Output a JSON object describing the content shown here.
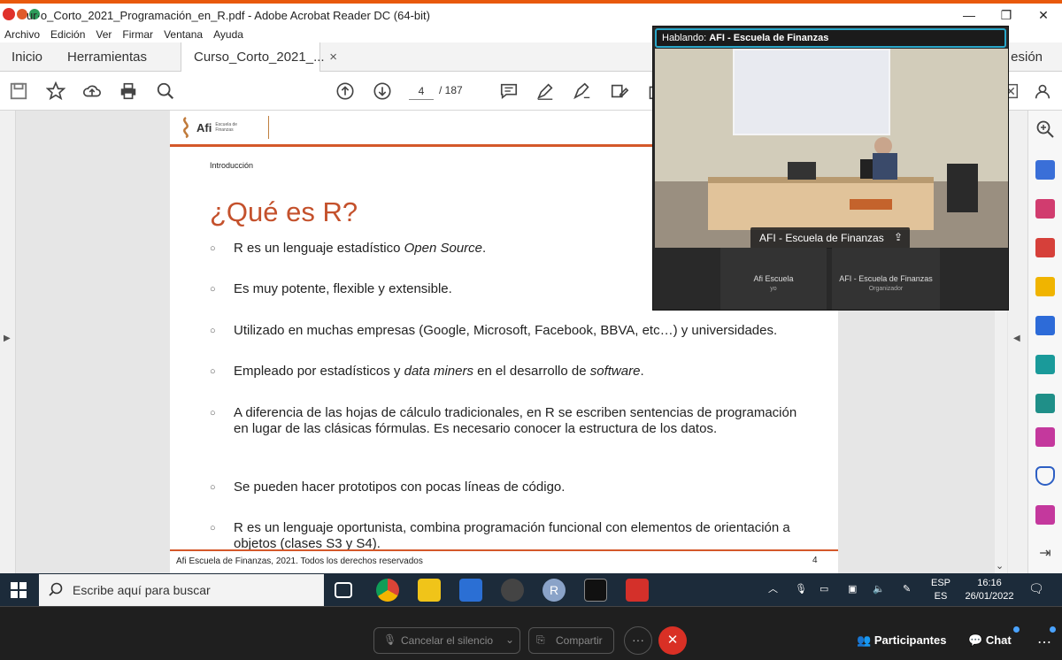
{
  "window": {
    "title": "Curso_Corto_2021_Programación_en_R.pdf - Adobe Acrobat Reader DC (64-bit)",
    "title_visible": "ur·o_Corto_2021_Programación_en_R.pdf - Adobe Acrobat Reader DC (64-bit)",
    "controls": [
      "—",
      "❐",
      "✕"
    ]
  },
  "menu": [
    "Archivo",
    "Edición",
    "Ver",
    "Firmar",
    "Ventana",
    "Ayuda"
  ],
  "tabs": {
    "home": "Inicio",
    "tools": "Herramientas",
    "document": "Curso_Corto_2021_...",
    "close": "×",
    "signin": "esión"
  },
  "toolbar": {
    "current_page": "4",
    "total_pages": "/ 187"
  },
  "page": {
    "logo_brand": "Afi",
    "logo_sub": "Escuela de Finanzas",
    "section": "Introducción",
    "heading": "¿Qué es R?",
    "bullets": [
      {
        "pre": "R es un lenguaje estadístico ",
        "em": "Open Source",
        "post": "."
      },
      {
        "pre": "Es muy potente, flexible y extensible.",
        "em": "",
        "post": ""
      },
      {
        "pre": "Utilizado en muchas empresas (Google, Microsoft, Facebook, BBVA, etc…) y universidades.",
        "em": "",
        "post": ""
      },
      {
        "pre": "Empleado por estadísticos y ",
        "em": "data miners",
        "post": " en el desarrollo de ",
        "em2": "software",
        "post2": "."
      },
      {
        "pre": "A diferencia de las hojas de cálculo tradicionales, en R se escriben sentencias de programación en lugar de las clásicas fórmulas. Es necesario conocer la estructura de los datos.",
        "em": "",
        "post": ""
      },
      {
        "pre": "Se pueden hacer prototipos con pocas líneas de código.",
        "em": "",
        "post": ""
      },
      {
        "pre": "R es un lenguaje oportunista, combina programación funcional con elementos de orientación a objetos (clases S3 y S4).",
        "em": "",
        "post": ""
      }
    ],
    "footer": "Afi Escuela de Finanzas, 2021. Todos los derechos reservados",
    "page_number": "4"
  },
  "meeting": {
    "speaking_label": "Hablando:",
    "speaking_name": "AFI - Escuela de Finanzas",
    "video_label": "AFI - Escuela de Finanzas",
    "participants": [
      {
        "name": "Afi Escuela",
        "role": "yo"
      },
      {
        "name": "AFI - Escuela de Finanzas",
        "role": "Organizador"
      }
    ]
  },
  "taskbar": {
    "search_placeholder": "Escribe aquí para buscar",
    "lang_top": "ESP",
    "lang_bottom": "ES",
    "time": "16:16",
    "date": "26/01/2022"
  },
  "meetbar": {
    "unmute": "Cancelar el silencio",
    "share": "Compartir",
    "more": "···",
    "leave": "✕",
    "participants": "Participantes",
    "chat": "Chat"
  },
  "colors": {
    "accent_orange": "#e8590c",
    "heading_red": "#c4512c",
    "speaker_border": "#2aa7c9",
    "leave_red": "#d93025",
    "taskbar_bg": "#1c2b3a"
  }
}
